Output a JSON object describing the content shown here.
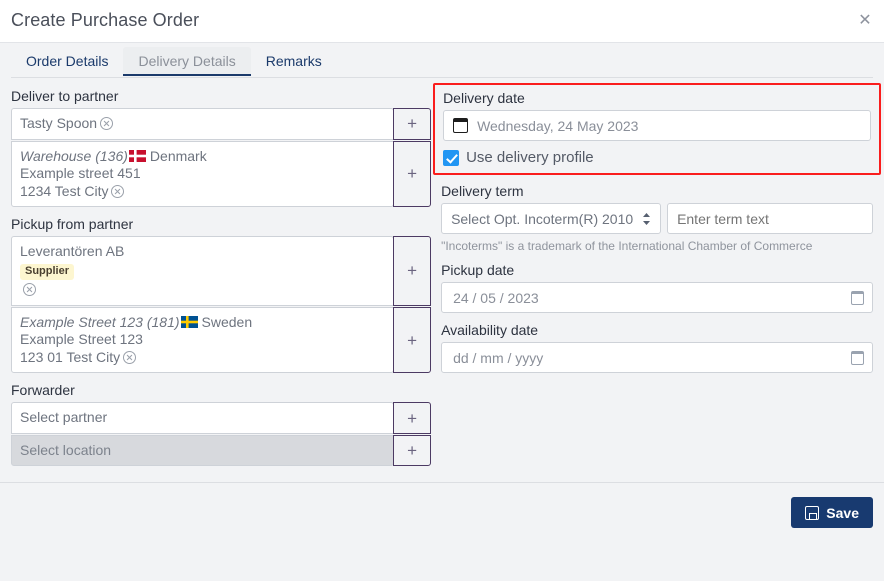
{
  "header": {
    "title": "Create Purchase Order",
    "close_label": "✕"
  },
  "tabs": [
    {
      "label": "Order Details",
      "active": false
    },
    {
      "label": "Delivery Details",
      "active": true
    },
    {
      "label": "Remarks",
      "active": false
    }
  ],
  "left": {
    "deliver_to_partner": {
      "label": "Deliver to partner",
      "partner_value": "Tasty Spoon",
      "location_title": "Warehouse (136)",
      "location_country": "Denmark",
      "location_flag": "denmark-flag",
      "location_street": "Example street 451",
      "location_city": "1234 Test City",
      "add_label": "+"
    },
    "pickup_from_partner": {
      "label": "Pickup from partner",
      "partner_value": "Leverantören AB",
      "partner_badge": "Supplier",
      "location_title": "Example Street 123 (181)",
      "location_country": "Sweden",
      "location_flag": "sweden-flag",
      "location_street": "Example Street 123",
      "location_city": "123 01 Test City",
      "add_label": "+"
    },
    "forwarder": {
      "label": "Forwarder",
      "partner_placeholder": "Select partner",
      "location_placeholder": "Select location",
      "add_label": "+"
    }
  },
  "right": {
    "delivery_date": {
      "label": "Delivery date",
      "value": "Wednesday, 24 May 2023",
      "icon": "calendar-icon",
      "checkbox_label": "Use delivery profile",
      "checkbox_checked": true,
      "highlight_color": "#fa1d1d"
    },
    "delivery_term": {
      "label": "Delivery term",
      "select_value": "Select Opt. Incoterm(R) 2010",
      "text_placeholder": "Enter term text",
      "note": "\"Incoterms\" is a trademark of the International Chamber of Commerce"
    },
    "pickup_date": {
      "label": "Pickup date",
      "value": "24 / 05 / 2023",
      "icon": "calendar-icon"
    },
    "availability_date": {
      "label": "Availability date",
      "value": "dd / mm / yyyy",
      "icon": "calendar-icon"
    }
  },
  "footer": {
    "save_label": "Save",
    "save_icon": "save-disk-icon",
    "save_color": "#183a70"
  }
}
